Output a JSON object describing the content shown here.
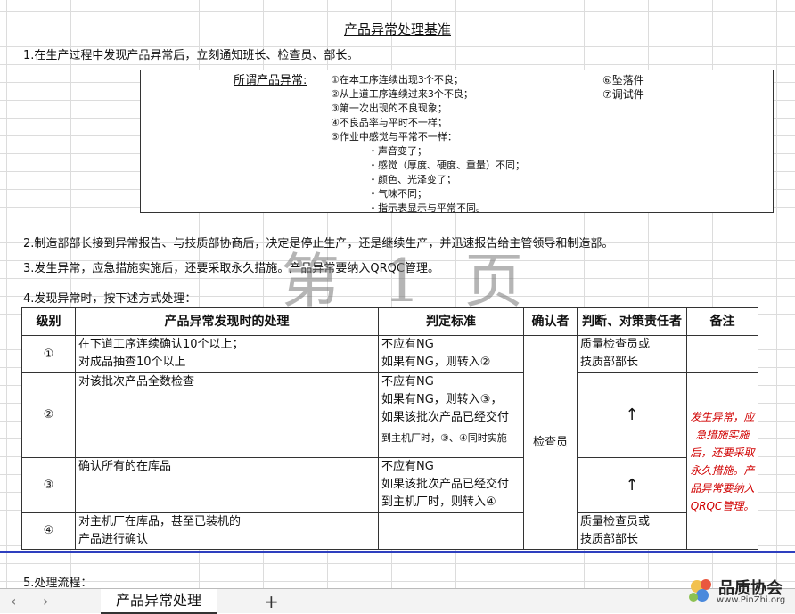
{
  "document": {
    "title": "产品异常处理基准",
    "item1": "1.在生产过程中发现产品异常后，立刻通知班长、检查员、部长。",
    "item2": "2.制造部部长接到异常报告、与技质部协商后，决定是停止生产，还是继续生产，并迅速报告给主管领导和制造部。",
    "item3": "3.发生异常，应急措施实施后，还要采取永久措施。产品异常要纳入QRQC管理。",
    "item4": "4.发现异常时，按下述方式处理：",
    "item5": "5.处理流程："
  },
  "definition": {
    "label": "所谓产品异常:",
    "items": [
      "①在本工序连续出现3个不良；",
      "②从上道工序连续过来3个不良；",
      "③第一次出现的不良现象；",
      "④不良品率与平时不一样；",
      "⑤作业中感觉与平常不一样："
    ],
    "sub_items": [
      "・声音变了；",
      "・感觉（厚度、硬度、重量）不同；",
      "・颜色、光泽变了；",
      "・气味不同；",
      "・指示表显示与平常不同。"
    ],
    "right_items": [
      "⑥坠落件",
      "⑦调试件"
    ]
  },
  "watermark": "第 1 页",
  "table": {
    "headers": [
      "级别",
      "产品异常发现时的处理",
      "判定标准",
      "确认者",
      "判断、对策责任者",
      "备注"
    ],
    "rows": [
      {
        "level": "①",
        "handling": [
          "在下道工序连续确认10个以上；",
          "对成品抽查10个以上"
        ],
        "criteria": [
          "不应有NG",
          "如果有NG，则转入②"
        ],
        "responsible": [
          "质量检查员或",
          "技质部部长"
        ]
      },
      {
        "level": "②",
        "handling": [
          "对该批次产品全数检查"
        ],
        "criteria": [
          "不应有NG",
          "如果有NG，则转入③，",
          "如果该批次产品已经交付",
          "到主机厂时，③、④同时实施"
        ],
        "responsible_arrow": "↑"
      },
      {
        "level": "③",
        "handling": [
          "确认所有的在库品"
        ],
        "criteria": [
          "不应有NG",
          "如果该批次产品已经交付",
          "到主机厂时，则转入④"
        ],
        "responsible_arrow": "↑"
      },
      {
        "level": "④",
        "handling": [
          "对主机厂在库品，甚至已装机的",
          "产品进行确认"
        ],
        "criteria": [],
        "responsible": [
          "质量检查员或",
          "技质部部长"
        ]
      }
    ],
    "confirmer": "检查员",
    "remark": "发生异常，应急措施实施后，还要采取永久措施。产品异常要纳入QRQC管理。"
  },
  "sheet_tabs": {
    "prev": "‹",
    "next": "›",
    "active_tab": "产品异常处理",
    "add": "+"
  },
  "logo": {
    "name": "品质协会",
    "url": "www.PinZhi.org"
  }
}
